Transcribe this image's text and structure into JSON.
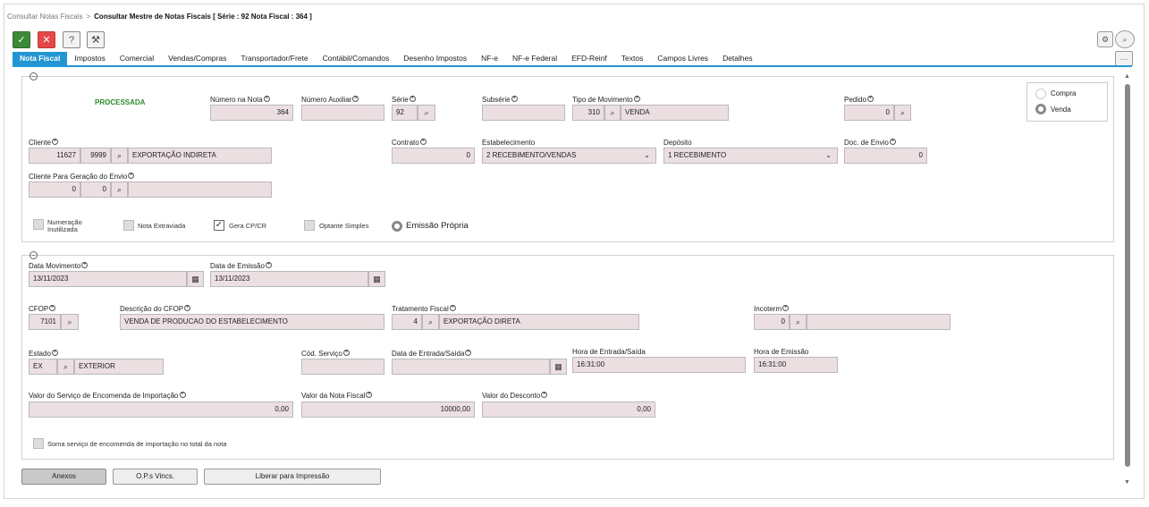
{
  "breadcrumb": {
    "parent": "Consultar Notas Fiscais",
    "separator": ">",
    "current": "Consultar Mestre de Notas Fiscais [ Série : 92 Nota Fiscal : 364 ]"
  },
  "toolbar": {
    "ok": "✓",
    "cancel": "✕",
    "help": "?",
    "tools": "⚒"
  },
  "right_buttons": {
    "settings": "⚙",
    "search": "⌕",
    "more": "···"
  },
  "tabs": [
    "Nota Fiscal",
    "Impostos",
    "Comercial",
    "Vendas/Compras",
    "Transportador/Frete",
    "Contábil/Comandos",
    "Desenho Impostos",
    "NF-e",
    "NF-e Federal",
    "EFD-Reinf",
    "Textos",
    "Campos Livres",
    "Detalhes"
  ],
  "section1": {
    "status": "PROCESSADA",
    "numero_nota": {
      "label": "Número na Nota",
      "value": "364"
    },
    "numero_auxiliar": {
      "label": "Número Auxiliar",
      "value": ""
    },
    "serie": {
      "label": "Série",
      "value": "92"
    },
    "subserie": {
      "label": "Subsérie",
      "value": ""
    },
    "tipo_movimento": {
      "label": "Tipo de Movimento",
      "code": "310",
      "desc": "VENDA"
    },
    "pedido": {
      "label": "Pedido",
      "value": "0"
    },
    "radio": {
      "compra": "Compra",
      "venda": "Venda"
    },
    "cliente": {
      "label": "Cliente",
      "code": "11627",
      "sub": "9999",
      "desc": "EXPORTAÇÃO INDIRETA"
    },
    "contrato": {
      "label": "Contrato",
      "value": "0"
    },
    "estabelecimento": {
      "label": "Estabelecimento",
      "value": "2 RECEBIMENTO/VENDAS"
    },
    "deposito": {
      "label": "Depósito",
      "value": "1 RECEBIMENTO"
    },
    "doc_envio": {
      "label": "Doc. de Envio",
      "value": "0"
    },
    "cliente_envio": {
      "label": "Cliente Para Geração do Envio",
      "code": "0",
      "sub": "0",
      "desc": ""
    },
    "checks": {
      "numeracao": "Numeração Inutilizada",
      "extraviada": "Nota Extraviada",
      "gera": "Gera CP/CR",
      "optante": "Optante Simples",
      "emissao": "Emissão Própria"
    }
  },
  "section2": {
    "data_movimento": {
      "label": "Data Movimento",
      "value": "13/11/2023"
    },
    "data_emissao": {
      "label": "Data de Emissão",
      "value": "13/11/2023"
    },
    "cfop": {
      "label": "CFOP",
      "value": "7101"
    },
    "desc_cfop": {
      "label": "Descrição do CFOP",
      "value": "VENDA DE PRODUCAO DO ESTABELECIMENTO"
    },
    "tratamento": {
      "label": "Tratamento Fiscal",
      "code": "4",
      "desc": "EXPORTAÇÃO DIRETA"
    },
    "incoterm": {
      "label": "Incoterm",
      "code": "0",
      "desc": ""
    },
    "estado": {
      "label": "Estado",
      "code": "EX",
      "desc": "EXTERIOR"
    },
    "cod_servico": {
      "label": "Cód. Serviço",
      "value": ""
    },
    "data_entrada": {
      "label": "Data de Entrada/Saída",
      "value": ""
    },
    "hora_entrada": {
      "label": "Hora de Entrada/Saída",
      "value": "16:31:00"
    },
    "hora_emissao": {
      "label": "Hora de Emissão",
      "value": "16:31:00"
    },
    "valor_servico": {
      "label": "Valor do Serviço de Encomenda de Importação",
      "value": "0,00"
    },
    "valor_nota": {
      "label": "Valor da Nota Fiscal",
      "value": "10000,00"
    },
    "valor_desconto": {
      "label": "Valor do Desconto",
      "value": "0,00"
    },
    "soma_check": "Soma serviço de encomenda de importação no total da nota"
  },
  "bottom_buttons": {
    "anexos": "Anexos",
    "ops": "O.P.s Vincs.",
    "liberar": "Liberar para Impressão"
  },
  "colors": {
    "accent": "#2196d3",
    "field_bg": "#ecdfe2",
    "ok": "#3a8a3a",
    "cancel": "#e54848",
    "status": "#2e8b2e"
  }
}
